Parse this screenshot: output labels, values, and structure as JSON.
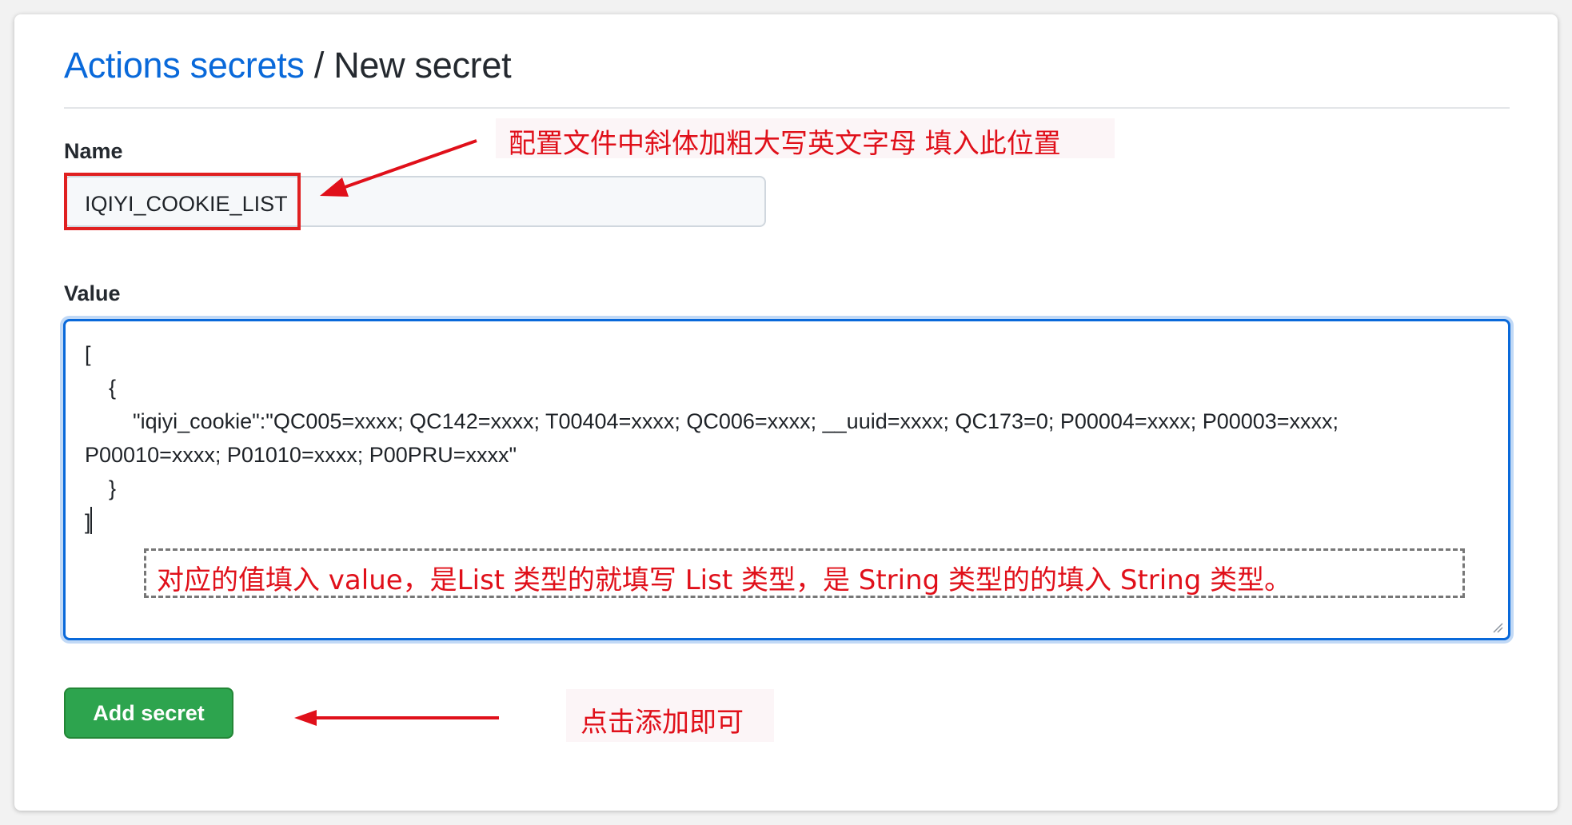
{
  "header": {
    "breadcrumb_link": "Actions secrets",
    "separator": " / ",
    "title": "New secret"
  },
  "name_field": {
    "label": "Name",
    "value": "IQIYI_COOKIE_LIST"
  },
  "value_field": {
    "label": "Value",
    "lines": [
      "[",
      "    {",
      "        \"iqiyi_cookie\":\"QC005=xxxx; QC142=xxxx; T00404=xxxx; QC006=xxxx; __uuid=xxxx; QC173=0; P00004=xxxx; P00003=xxxx;",
      "P00010=xxxx; P01010=xxxx; P00PRU=xxxx\"",
      "    }",
      "]"
    ]
  },
  "submit_button": {
    "label": "Add secret"
  },
  "annotations": {
    "name_note": "配置文件中斜体加粗大写英文字母 填入此位置",
    "value_note": "对应的值填入 value，是List 类型的就填写 List 类型，是 String 类型的的填入 String 类型。",
    "button_note": "点击添加即可"
  },
  "colors": {
    "link": "#0969da",
    "button": "#2da44e",
    "annotation": "#e0101a",
    "focus_border": "#0969da"
  }
}
